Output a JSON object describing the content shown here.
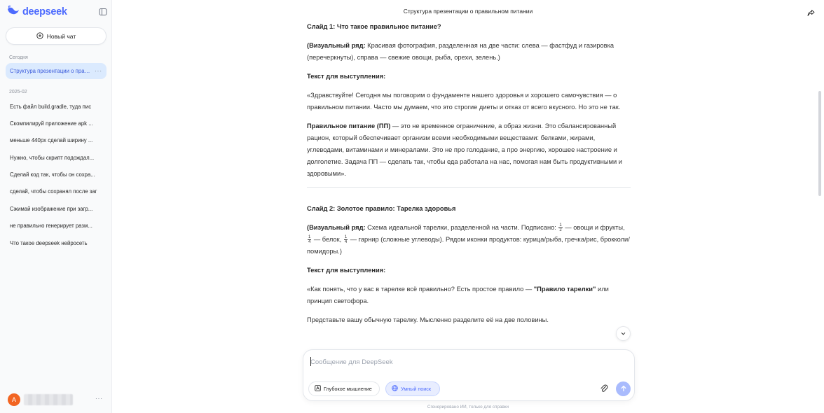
{
  "sidebar": {
    "logo_text": "deepseek",
    "new_chat_label": "Новый чат",
    "sections": [
      {
        "label": "Сегодня",
        "items": [
          {
            "label": "Структура презентации о правильном питании",
            "active": true
          }
        ]
      },
      {
        "label": "2025-02",
        "items": [
          {
            "label": "Есть файл build.gradle, туда пис"
          },
          {
            "label": "Скомпилируй приложение apk ..."
          },
          {
            "label": "меньше 440px сделай ширину ..."
          },
          {
            "label": "Нужно, чтобы скрипт подождал..."
          },
          {
            "label": "Сделай код так, чтобы он сохра..."
          },
          {
            "label": "сделай, чтобы сохранял после заг"
          },
          {
            "label": "Сжимай изображение при загр..."
          },
          {
            "label": "не правильно генерирует разм..."
          },
          {
            "label": "Что такое deepseek нейросеть"
          }
        ]
      }
    ],
    "more_glyph": "···",
    "user": {
      "avatar_letter": "A"
    }
  },
  "header": {
    "title": "Структура презентации о правильном питании"
  },
  "message": {
    "slide1": {
      "heading": "Слайд 1: Что такое правильное питание?",
      "visual_label": "(Визуальный ряд:",
      "visual_text": " Красивая фотография, разделенная на две части: слева — фастфуд и газировка (перечеркнуты), справа — свежие овощи, рыба, орехи, зелень.)",
      "speech_label": "Текст для выступления:",
      "speech_p1": "«Здравствуйте! Сегодня мы поговорим о фундаменте нашего здоровья и хорошего самочувствия — о правильном питании. Часто мы думаем, что это строгие диеты и отказ от всего вкусного. Но это не так.",
      "pp_bold": "Правильное питание (ПП)",
      "pp_text": " — это не временное ограничение, а образ жизни. Это сбалансированный рацион, который обеспечивает организм всеми необходимыми веществами: белками, жирами, углеводами, витаминами и минералами. Это не про голодание, а про энергию, хорошее настроение и долголетие. Задача ПП — сделать так, чтобы еда работала на нас, помогая нам быть продуктивными и здоровыми»."
    },
    "slide2": {
      "heading": "Слайд 2: Золотое правило: Тарелка здоровья",
      "visual_label": "(Визуальный ряд:",
      "visual_a": " Схема идеальной тарелки, разделенной на части. Подписано: ",
      "frac_half_n": "1",
      "frac_half_d": "2",
      "visual_b": " — овощи и фрукты, ",
      "frac_q1_n": "1",
      "frac_q1_d": "4",
      "visual_c": " — белок, ",
      "frac_q2_n": "1",
      "frac_q2_d": "4",
      "visual_d": " — гарнир (сложные углеводы). Рядом иконки продуктов: курица/рыба, гречка/рис, брокколи/помидоры.)",
      "speech_label": "Текст для выступления:",
      "speech_a": "«Как понять, что у вас в тарелке всё правильно? Есть простое правило — ",
      "speech_bold": "\"Правило тарелки\"",
      "speech_b": " или принцип светофора.",
      "speech_p2": "Представьте вашу обычную тарелку. Мысленно разделите её на две половины."
    }
  },
  "composer": {
    "placeholder": "Сообщение для DeepSeek",
    "deep_thinking_label": "Глубокое мышление",
    "smart_search_label": "Умный поиск"
  },
  "footnote": "Сгенерировано ИИ, только для справки",
  "colors": {
    "brand": "#4d6bfe",
    "active_item_bg": "#dbeafe",
    "send_button": "#a9bbfd",
    "avatar": "#f26522"
  }
}
